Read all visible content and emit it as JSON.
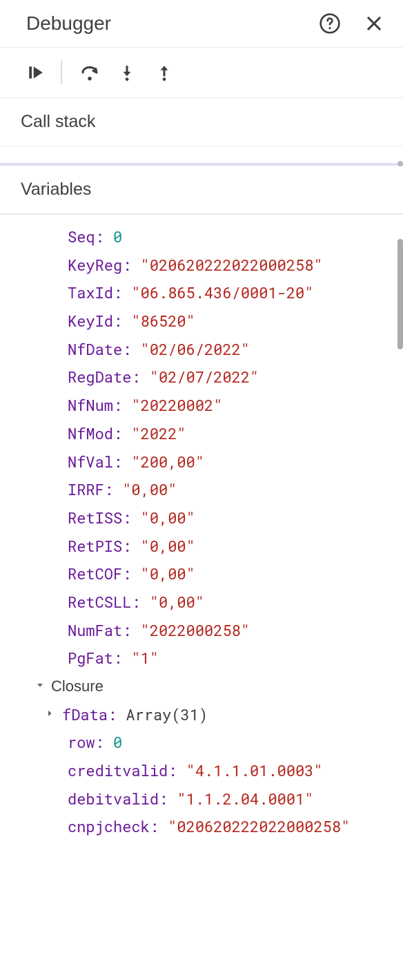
{
  "header": {
    "title": "Debugger"
  },
  "sections": {
    "callstack": "Call stack",
    "variables": "Variables",
    "closure": "Closure"
  },
  "vars": [
    {
      "k": "Seq",
      "v": "0",
      "t": "num"
    },
    {
      "k": "KeyReg",
      "v": "\"020620222022000258\"",
      "t": "str"
    },
    {
      "k": "TaxId",
      "v": "\"06.865.436/0001-20\"",
      "t": "str"
    },
    {
      "k": "KeyId",
      "v": "\"86520\"",
      "t": "str"
    },
    {
      "k": "NfDate",
      "v": "\"02/06/2022\"",
      "t": "str"
    },
    {
      "k": "RegDate",
      "v": "\"02/07/2022\"",
      "t": "str"
    },
    {
      "k": "NfNum",
      "v": "\"20220002\"",
      "t": "str"
    },
    {
      "k": "NfMod",
      "v": "\"2022\"",
      "t": "str"
    },
    {
      "k": "NfVal",
      "v": "\"200,00\"",
      "t": "str"
    },
    {
      "k": "IRRF",
      "v": "\"0,00\"",
      "t": "str"
    },
    {
      "k": "RetISS",
      "v": "\"0,00\"",
      "t": "str"
    },
    {
      "k": "RetPIS",
      "v": "\"0,00\"",
      "t": "str"
    },
    {
      "k": "RetCOF",
      "v": "\"0,00\"",
      "t": "str"
    },
    {
      "k": "RetCSLL",
      "v": "\"0,00\"",
      "t": "str"
    },
    {
      "k": "NumFat",
      "v": "\"2022000258\"",
      "t": "str"
    },
    {
      "k": "PgFat",
      "v": "\"1\"",
      "t": "str"
    }
  ],
  "fdata": {
    "label": "fData",
    "typeLabel": "Array(31)"
  },
  "closureVars": [
    {
      "k": "row",
      "v": "0",
      "t": "num"
    },
    {
      "k": "creditvalid",
      "v": "\"4.1.1.01.0003\"",
      "t": "str"
    },
    {
      "k": "debitvalid",
      "v": "\"1.1.2.04.0001\"",
      "t": "str"
    },
    {
      "k": "cnpjcheck",
      "v": "\"020620222022000258\"",
      "t": "str"
    }
  ]
}
